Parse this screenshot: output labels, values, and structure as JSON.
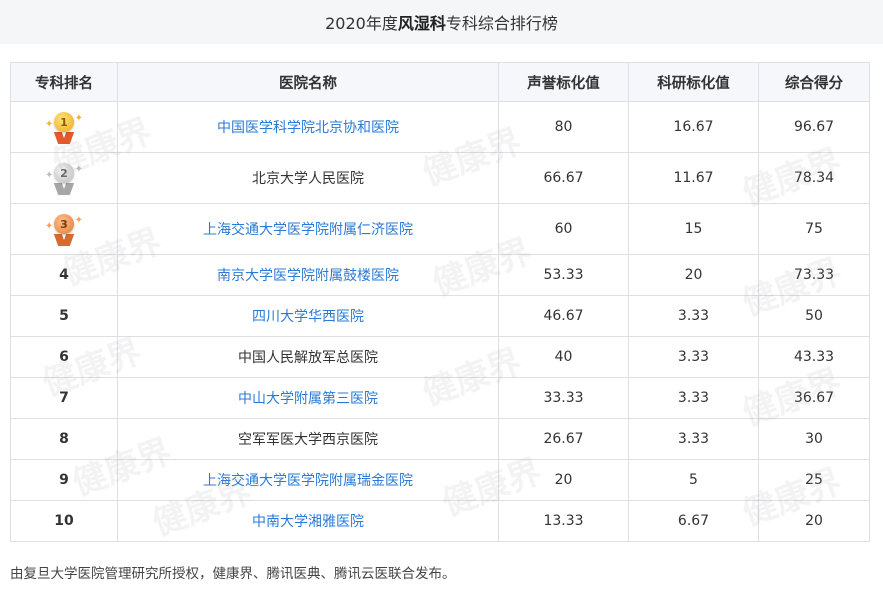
{
  "title": {
    "prefix": "2020年度",
    "specialty": "风湿科",
    "suffix": "专科综合排行榜"
  },
  "table": {
    "headers": [
      "专科排名",
      "医院名称",
      "声誉标化值",
      "科研标化值",
      "综合得分"
    ],
    "rows": [
      {
        "rank": "1",
        "medal": "gold",
        "hospital": "中国医学科学院北京协和医院",
        "link": true,
        "reputation": "80",
        "research": "16.67",
        "score": "96.67"
      },
      {
        "rank": "2",
        "medal": "silver",
        "hospital": "北京大学人民医院",
        "link": false,
        "reputation": "66.67",
        "research": "11.67",
        "score": "78.34"
      },
      {
        "rank": "3",
        "medal": "bronze",
        "hospital": "上海交通大学医学院附属仁济医院",
        "link": true,
        "reputation": "60",
        "research": "15",
        "score": "75"
      },
      {
        "rank": "4",
        "medal": "",
        "hospital": "南京大学医学院附属鼓楼医院",
        "link": true,
        "reputation": "53.33",
        "research": "20",
        "score": "73.33"
      },
      {
        "rank": "5",
        "medal": "",
        "hospital": "四川大学华西医院",
        "link": true,
        "reputation": "46.67",
        "research": "3.33",
        "score": "50"
      },
      {
        "rank": "6",
        "medal": "",
        "hospital": "中国人民解放军总医院",
        "link": false,
        "reputation": "40",
        "research": "3.33",
        "score": "43.33"
      },
      {
        "rank": "7",
        "medal": "",
        "hospital": "中山大学附属第三医院",
        "link": true,
        "reputation": "33.33",
        "research": "3.33",
        "score": "36.67"
      },
      {
        "rank": "8",
        "medal": "",
        "hospital": "空军军医大学西京医院",
        "link": false,
        "reputation": "26.67",
        "research": "3.33",
        "score": "30"
      },
      {
        "rank": "9",
        "medal": "",
        "hospital": "上海交通大学医学院附属瑞金医院",
        "link": true,
        "reputation": "20",
        "research": "5",
        "score": "25"
      },
      {
        "rank": "10",
        "medal": "",
        "hospital": "中南大学湘雅医院",
        "link": true,
        "reputation": "13.33",
        "research": "6.67",
        "score": "20"
      }
    ]
  },
  "footer": "由复旦大学医院管理研究所授权，健康界、腾讯医典、腾讯云医联合发布。",
  "watermark_text": "健康界",
  "colors": {
    "link": "#2b7bd6",
    "header_bg": "#f5f7fa",
    "border": "#dcdfe6"
  }
}
